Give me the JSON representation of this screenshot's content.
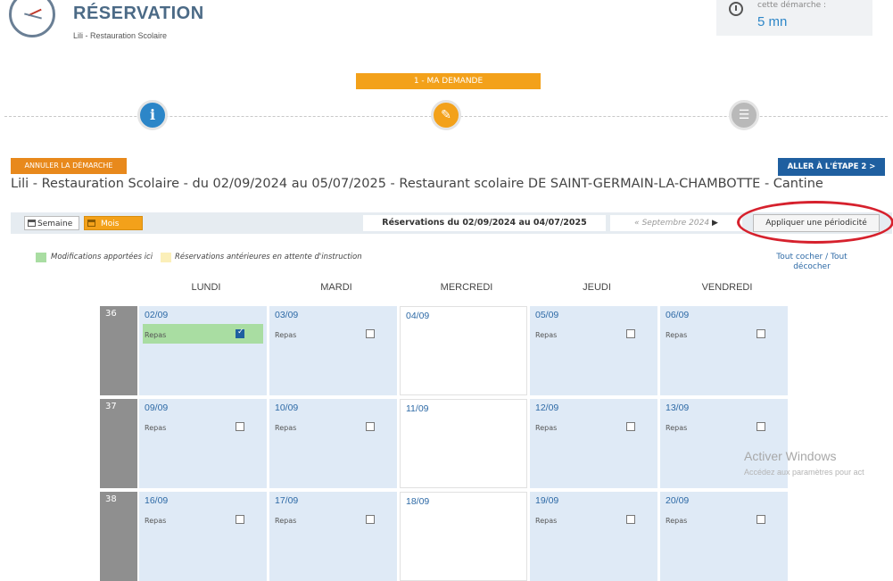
{
  "header": {
    "title": "RÉSERVATION",
    "subtitle": "Lili - Restauration Scolaire",
    "duration_label": "cette démarche :",
    "duration_value": "5 mn"
  },
  "steps": {
    "current_label": "1 - MA DEMANDE",
    "icons": [
      "info-icon",
      "pencil-icon",
      "list-icon"
    ]
  },
  "actions": {
    "cancel_label": "ANNULER LA DÉMARCHE",
    "next_label": "ALLER À L'ÉTAPE 2 >"
  },
  "heading": "Lili - Restauration Scolaire - du 02/09/2024 au 05/07/2025 - Restaurant scolaire DE SAINT-GERMAIN-LA-CHAMBOTTE - Cantine",
  "toolbar": {
    "week_label": "Semaine",
    "month_label": "Mois",
    "period_label": "Réservations du 02/09/2024 au 04/07/2025",
    "month_nav_prev": "«",
    "month_nav_label": "Septembre 2024",
    "month_nav_next": "▶",
    "periodicity_label": "Appliquer une périodicité"
  },
  "legend": {
    "green_label": "Modifications apportées ici",
    "yellow_label": "Réservations antérieures en attente d'instruction",
    "check_all": "Tout cocher",
    "separator": "/",
    "uncheck_all": "Tout décocher"
  },
  "calendar": {
    "days": [
      "LUNDI",
      "MARDI",
      "MERCREDI",
      "JEUDI",
      "VENDREDI"
    ],
    "meal_label": "Repas",
    "weeks": [
      {
        "number": "36",
        "cells": [
          {
            "date": "02/09",
            "meal": true,
            "checked": true,
            "modified": true
          },
          {
            "date": "03/09",
            "meal": true,
            "checked": false
          },
          {
            "date": "04/09",
            "meal": false
          },
          {
            "date": "05/09",
            "meal": true,
            "checked": false
          },
          {
            "date": "06/09",
            "meal": true,
            "checked": false
          }
        ]
      },
      {
        "number": "37",
        "cells": [
          {
            "date": "09/09",
            "meal": true,
            "checked": false
          },
          {
            "date": "10/09",
            "meal": true,
            "checked": false
          },
          {
            "date": "11/09",
            "meal": false
          },
          {
            "date": "12/09",
            "meal": true,
            "checked": false
          },
          {
            "date": "13/09",
            "meal": true,
            "checked": false
          }
        ]
      },
      {
        "number": "38",
        "cells": [
          {
            "date": "16/09",
            "meal": true,
            "checked": false
          },
          {
            "date": "17/09",
            "meal": true,
            "checked": false
          },
          {
            "date": "18/09",
            "meal": false
          },
          {
            "date": "19/09",
            "meal": true,
            "checked": false
          },
          {
            "date": "20/09",
            "meal": true,
            "checked": false
          }
        ]
      }
    ]
  },
  "watermark": {
    "line1": "Activer Windows",
    "line2": "Accédez aux paramètres pour act"
  },
  "colors": {
    "accent_orange": "#f3a11a",
    "primary_blue": "#1f5fa0",
    "modified_green": "#a9dda2",
    "pending_yellow": "#fbefb9",
    "day_cell_blue": "#dfeaf6",
    "annotation_red": "#d6212d"
  }
}
